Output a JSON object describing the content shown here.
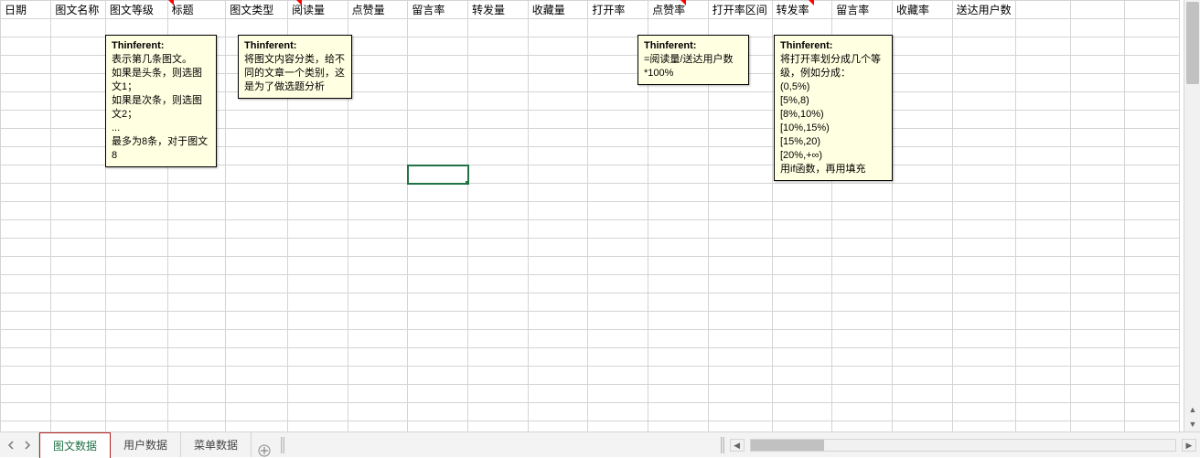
{
  "headers": [
    "日期",
    "图文名称",
    "图文等级",
    "标题",
    "图文类型",
    "阅读量",
    "点赞量",
    "留言率",
    "转发量",
    "收藏量",
    "打开率",
    "点赞率",
    "打开率区间",
    "转发率",
    "留言率",
    "收藏率",
    "送达用户数"
  ],
  "selected_cell_ref": "H10",
  "comments": {
    "c1": {
      "author": "Thinferent:",
      "lines": [
        "表示第几条图文。",
        "如果是头条，则选图文1；",
        "如果是次条，则选图文2；",
        "...",
        "最多为8条，对于图文8"
      ]
    },
    "c2": {
      "author": "Thinferent:",
      "lines": [
        "将图文内容分类，给不同的文章一个类别，这是为了做选题分析"
      ]
    },
    "c3": {
      "author": "Thinferent:",
      "lines": [
        "=阅读量/送达用户数*100%"
      ]
    },
    "c4": {
      "author": "Thinferent:",
      "lines": [
        "将打开率划分成几个等级，例如分成：",
        "(0,5%)",
        "[5%,8)",
        "[8%,10%)",
        "[10%,15%)",
        "[15%,20)",
        "[20%,+∞)",
        "用if函数，再用填充"
      ]
    }
  },
  "sheets": {
    "active": "图文数据",
    "others": [
      "用户数据",
      "菜单数据"
    ]
  },
  "icons": {
    "first": "first-icon",
    "prev": "prev-icon",
    "next": "next-icon",
    "add": "add-sheet-icon"
  }
}
